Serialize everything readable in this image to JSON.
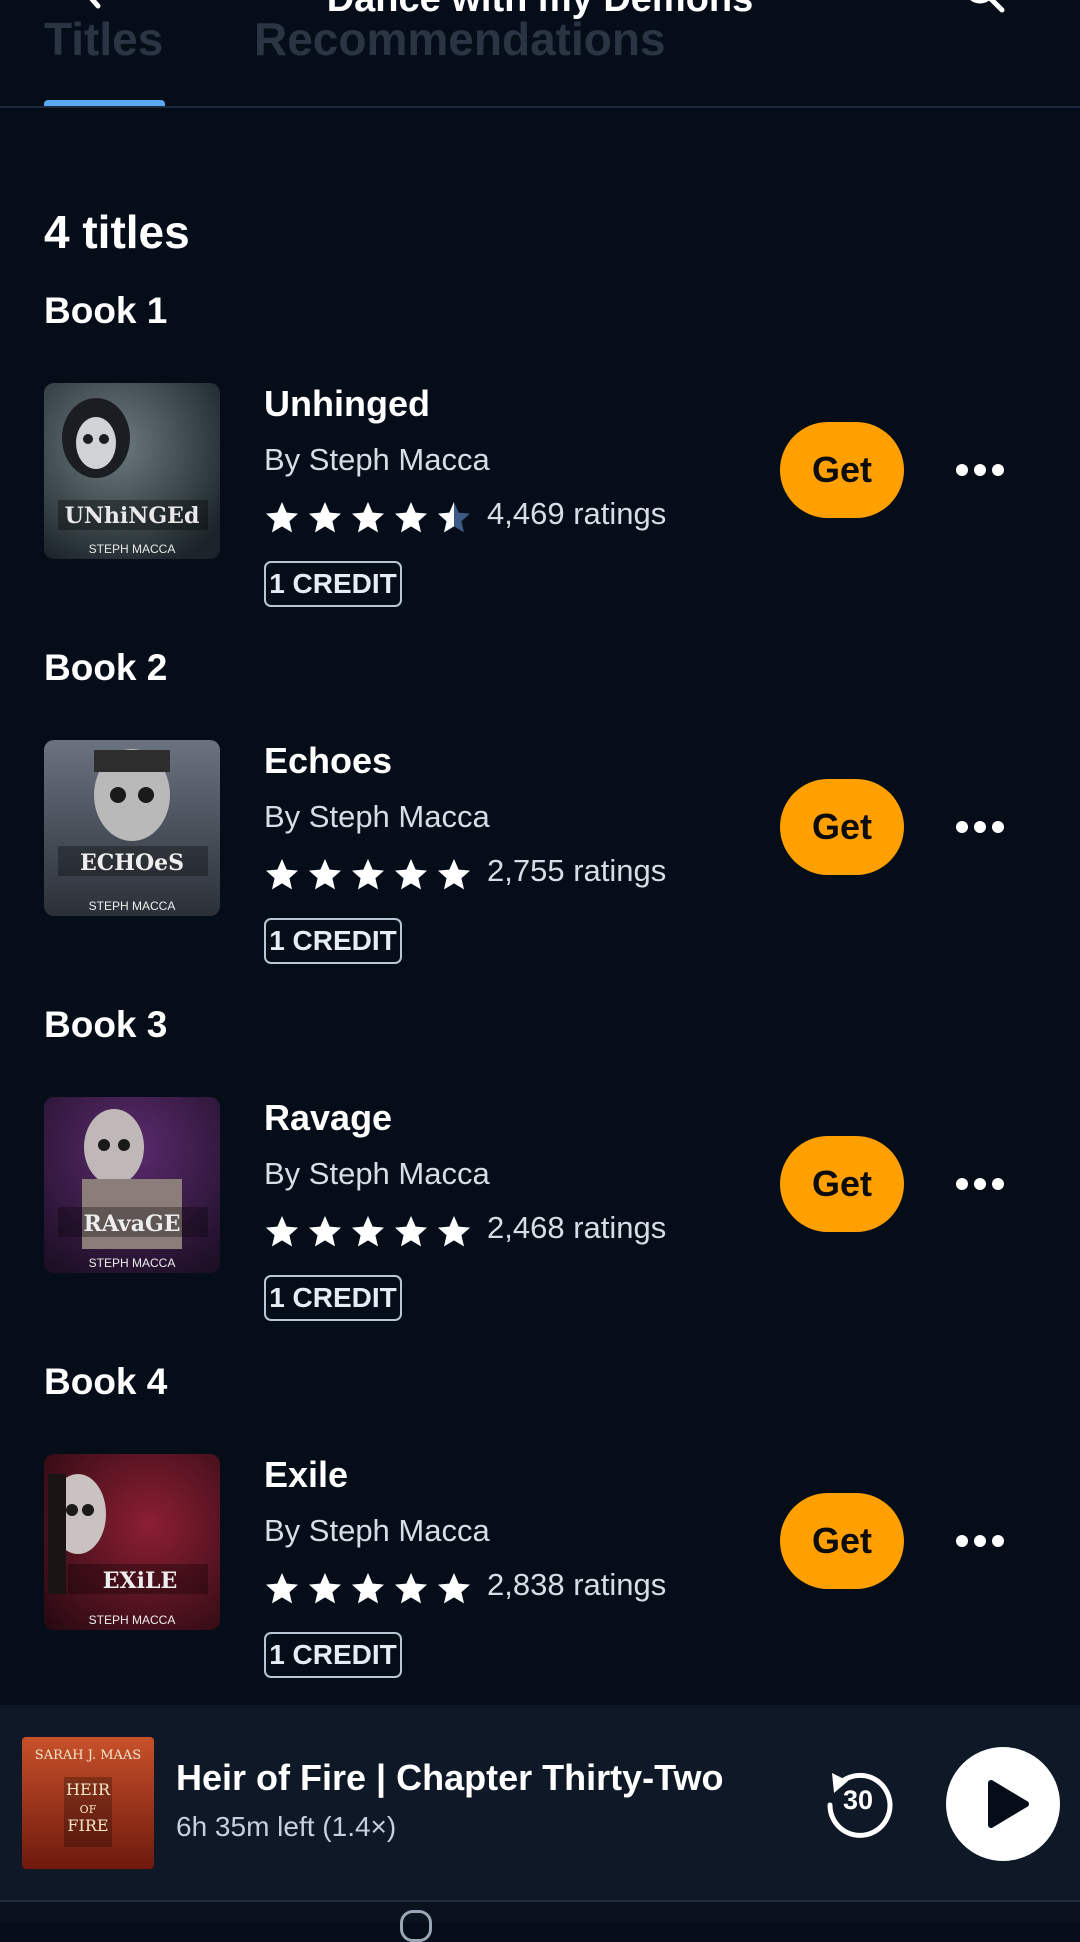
{
  "header": {
    "title": "Dance with my Demons",
    "tabs": [
      {
        "label": "Titles",
        "active": true
      },
      {
        "label": "Recommendations",
        "active": false
      }
    ]
  },
  "count_label": "4 titles",
  "books": [
    {
      "book_label": "Book 1",
      "title": "Unhinged",
      "author": "By Steph Macca",
      "rating": 4.5,
      "ratings_text": "4,469 ratings",
      "credit": "1 CREDIT",
      "get_label": "Get",
      "cover_text": "UNhiNGEd",
      "cover_author": "STEPH MACCA"
    },
    {
      "book_label": "Book 2",
      "title": "Echoes",
      "author": "By Steph Macca",
      "rating": 5,
      "ratings_text": "2,755 ratings",
      "credit": "1 CREDIT",
      "get_label": "Get",
      "cover_text": "ECHOeS",
      "cover_author": "STEPH MACCA"
    },
    {
      "book_label": "Book 3",
      "title": "Ravage",
      "author": "By Steph Macca",
      "rating": 5,
      "ratings_text": "2,468 ratings",
      "credit": "1 CREDIT",
      "get_label": "Get",
      "cover_text": "RAvaGE",
      "cover_author": "STEPH MACCA"
    },
    {
      "book_label": "Book 4",
      "title": "Exile",
      "author": "By Steph Macca",
      "rating": 5,
      "ratings_text": "2,838 ratings",
      "credit": "1 CREDIT",
      "get_label": "Get",
      "cover_text": "EXiLE",
      "cover_author": "STEPH MACCA"
    }
  ],
  "player": {
    "title": "Heir of Fire | Chapter Thirty-Two",
    "subtitle": "6h 35m left (1.4×)",
    "rewind_seconds": "30",
    "cover_author": "SARAH J. MAAS",
    "cover_title_1": "HEIR",
    "cover_title_2": "OF",
    "cover_title_3": "FIRE"
  },
  "colors": {
    "background": "#050d18",
    "accent_tab": "#5aa9f5",
    "get_button": "#ff9f00",
    "star_empty": "#3d5a86"
  }
}
